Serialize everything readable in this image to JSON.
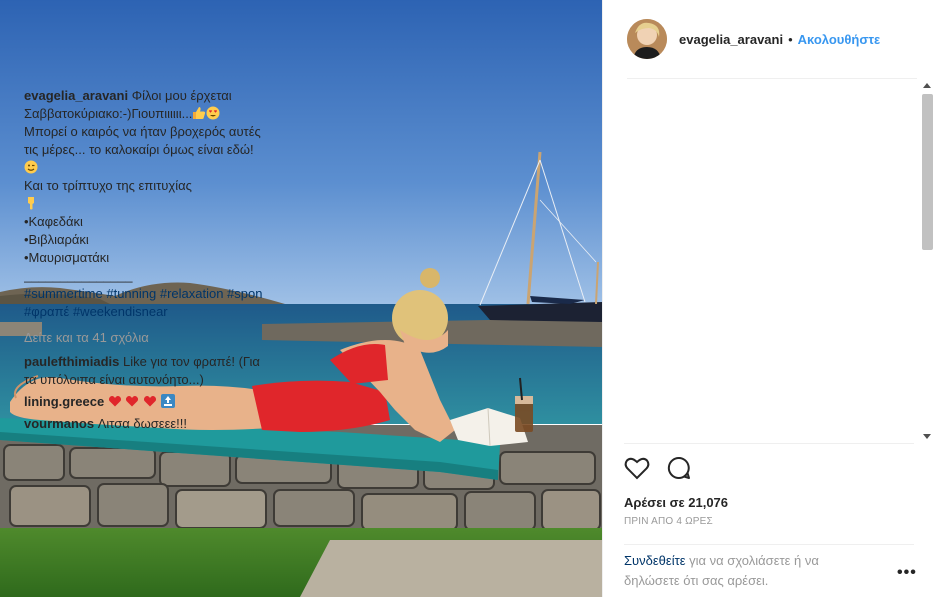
{
  "post": {
    "username": "evagelia_aravani",
    "follow_label": "Ακολουθήστε",
    "separator": "•",
    "caption": {
      "line1": "Φίλοι μου έρχεται",
      "line2": "Σαββατοκύριακο:-)Γιουπιιιιιι...",
      "line3": "Μπορεί ο καιρός να ήταν βροχερός αυτές",
      "line4": "τις μέρες... το καλοκαίρι όμως είναι εδώ!",
      "line5": "Και το τρίπτυχο της επιτυχίας",
      "item1": "•Καφεδάκι",
      "item2": "•Βιβλιαράκι",
      "item3": "•Μαυρισματάκι",
      "rule": "_______________",
      "tags_line1": "#summertime #tunning #relaxation #spon",
      "tags_line2": "#φραπέ #weekendisnear"
    },
    "view_all_comments": "Δείτε και τα 41 σχόλια",
    "comments": [
      {
        "user": "paulefthimiadis",
        "text": "Like για τον φραπέ! (Για",
        "text2": "τα υπόλοιπα είναι αυτονόητο...)"
      },
      {
        "user": "lining.greece",
        "text": ""
      },
      {
        "user": "vourmanos",
        "text": "Λιτσα δωσεεε!!!"
      }
    ],
    "likes": "Αρέσει σε 21,076",
    "time_ago": "ΠΡΙΝ ΑΠΟ 4 ΩΡΕΣ",
    "login_link": "Συνδεθείτε",
    "login_text1": "για να σχολιάσετε ή να",
    "login_text2": "δηλώσετε ότι σας αρέσει.",
    "more_options": "•••"
  },
  "icons": {
    "like": "heart-outline-icon",
    "comment": "speech-bubble-icon",
    "thumbs_up": "thumbs-up-emoji",
    "heart_eyes": "heart-eyes-emoji",
    "wink": "wink-emoji",
    "point_down": "point-down-emoji",
    "hearts": "red-heart-emoji",
    "top": "top-arrow-emoji"
  },
  "colors": {
    "accent_link": "#3897f0",
    "hashtag": "#003569",
    "muted": "#999999",
    "swimsuit": "#e0262b",
    "towel": "#1f9a9c"
  }
}
